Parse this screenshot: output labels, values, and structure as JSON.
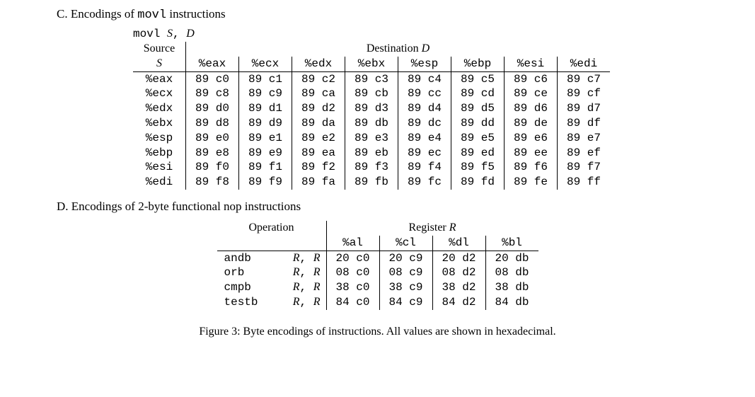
{
  "sectionC": {
    "heading_prefix": "C. Encodings of ",
    "heading_mono": "movl",
    "heading_suffix": " instructions",
    "syntax_mono": "movl ",
    "syntax_S": "S",
    "syntax_comma": ", ",
    "syntax_D": "D",
    "source_label": "Source",
    "source_S": "S",
    "dest_label_prefix": "Destination ",
    "dest_label_D": "D",
    "registers": [
      "%eax",
      "%ecx",
      "%edx",
      "%ebx",
      "%esp",
      "%ebp",
      "%esi",
      "%edi"
    ],
    "rows": [
      {
        "reg": "%eax",
        "cells": [
          "89 c0",
          "89 c1",
          "89 c2",
          "89 c3",
          "89 c4",
          "89 c5",
          "89 c6",
          "89 c7"
        ]
      },
      {
        "reg": "%ecx",
        "cells": [
          "89 c8",
          "89 c9",
          "89 ca",
          "89 cb",
          "89 cc",
          "89 cd",
          "89 ce",
          "89 cf"
        ]
      },
      {
        "reg": "%edx",
        "cells": [
          "89 d0",
          "89 d1",
          "89 d2",
          "89 d3",
          "89 d4",
          "89 d5",
          "89 d6",
          "89 d7"
        ]
      },
      {
        "reg": "%ebx",
        "cells": [
          "89 d8",
          "89 d9",
          "89 da",
          "89 db",
          "89 dc",
          "89 dd",
          "89 de",
          "89 df"
        ]
      },
      {
        "reg": "%esp",
        "cells": [
          "89 e0",
          "89 e1",
          "89 e2",
          "89 e3",
          "89 e4",
          "89 e5",
          "89 e6",
          "89 e7"
        ]
      },
      {
        "reg": "%ebp",
        "cells": [
          "89 e8",
          "89 e9",
          "89 ea",
          "89 eb",
          "89 ec",
          "89 ed",
          "89 ee",
          "89 ef"
        ]
      },
      {
        "reg": "%esi",
        "cells": [
          "89 f0",
          "89 f1",
          "89 f2",
          "89 f3",
          "89 f4",
          "89 f5",
          "89 f6",
          "89 f7"
        ]
      },
      {
        "reg": "%edi",
        "cells": [
          "89 f8",
          "89 f9",
          "89 fa",
          "89 fb",
          "89 fc",
          "89 fd",
          "89 fe",
          "89 ff"
        ]
      }
    ]
  },
  "sectionD": {
    "heading": "D. Encodings of 2-byte functional nop instructions",
    "operation_label": "Operation",
    "register_label_prefix": "Register ",
    "register_label_R": "R",
    "registers": [
      "%al",
      "%cl",
      "%dl",
      "%bl"
    ],
    "op_args_R": "R",
    "op_args_comma": ", ",
    "rows": [
      {
        "op": "andb",
        "cells": [
          "20 c0",
          "20 c9",
          "20 d2",
          "20 db"
        ]
      },
      {
        "op": "orb",
        "cells": [
          "08 c0",
          "08 c9",
          "08 d2",
          "08 db"
        ]
      },
      {
        "op": "cmpb",
        "cells": [
          "38 c0",
          "38 c9",
          "38 d2",
          "38 db"
        ]
      },
      {
        "op": "testb",
        "cells": [
          "84 c0",
          "84 c9",
          "84 d2",
          "84 db"
        ]
      }
    ]
  },
  "caption": "Figure 3: Byte encodings of instructions. All values are shown in hexadecimal.",
  "chart_data": [
    {
      "type": "table",
      "title": "Encodings of movl instructions (Source S × Destination D)",
      "columns": [
        "%eax",
        "%ecx",
        "%edx",
        "%ebx",
        "%esp",
        "%ebp",
        "%esi",
        "%edi"
      ],
      "rows": [
        "%eax",
        "%ecx",
        "%edx",
        "%ebx",
        "%esp",
        "%ebp",
        "%esi",
        "%edi"
      ],
      "data": [
        [
          "89 c0",
          "89 c1",
          "89 c2",
          "89 c3",
          "89 c4",
          "89 c5",
          "89 c6",
          "89 c7"
        ],
        [
          "89 c8",
          "89 c9",
          "89 ca",
          "89 cb",
          "89 cc",
          "89 cd",
          "89 ce",
          "89 cf"
        ],
        [
          "89 d0",
          "89 d1",
          "89 d2",
          "89 d3",
          "89 d4",
          "89 d5",
          "89 d6",
          "89 d7"
        ],
        [
          "89 d8",
          "89 d9",
          "89 da",
          "89 db",
          "89 dc",
          "89 dd",
          "89 de",
          "89 df"
        ],
        [
          "89 e0",
          "89 e1",
          "89 e2",
          "89 e3",
          "89 e4",
          "89 e5",
          "89 e6",
          "89 e7"
        ],
        [
          "89 e8",
          "89 e9",
          "89 ea",
          "89 eb",
          "89 ec",
          "89 ed",
          "89 ee",
          "89 ef"
        ],
        [
          "89 f0",
          "89 f1",
          "89 f2",
          "89 f3",
          "89 f4",
          "89 f5",
          "89 f6",
          "89 f7"
        ],
        [
          "89 f8",
          "89 f9",
          "89 fa",
          "89 fb",
          "89 fc",
          "89 fd",
          "89 fe",
          "89 ff"
        ]
      ]
    },
    {
      "type": "table",
      "title": "Encodings of 2-byte functional nop instructions (Operation × Register R)",
      "columns": [
        "%al",
        "%cl",
        "%dl",
        "%bl"
      ],
      "rows": [
        "andb R, R",
        "orb R, R",
        "cmpb R, R",
        "testb R, R"
      ],
      "data": [
        [
          "20 c0",
          "20 c9",
          "20 d2",
          "20 db"
        ],
        [
          "08 c0",
          "08 c9",
          "08 d2",
          "08 db"
        ],
        [
          "38 c0",
          "38 c9",
          "38 d2",
          "38 db"
        ],
        [
          "84 c0",
          "84 c9",
          "84 d2",
          "84 db"
        ]
      ]
    }
  ]
}
